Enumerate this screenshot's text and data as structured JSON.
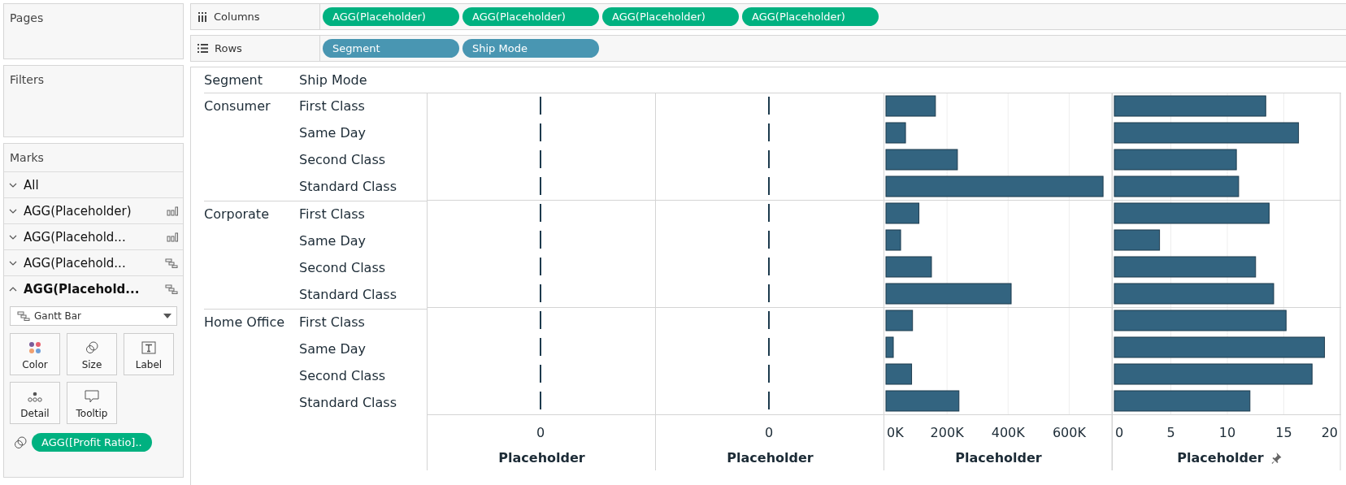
{
  "sidebar": {
    "pages": {
      "title": "Pages"
    },
    "filters": {
      "title": "Filters"
    },
    "marks": {
      "title": "Marks",
      "cards": [
        {
          "label": "All",
          "expanded": false,
          "kind": "all"
        },
        {
          "label": "AGG(Placeholder)",
          "expanded": false,
          "kind": "bar"
        },
        {
          "label": "AGG(Placehold...",
          "expanded": false,
          "kind": "bar"
        },
        {
          "label": "AGG(Placehold...",
          "expanded": false,
          "kind": "gantt"
        },
        {
          "label": "AGG(Placehold...",
          "expanded": true,
          "kind": "gantt"
        }
      ],
      "mark_type": "Gantt Bar",
      "buttons": [
        {
          "label": "Color",
          "kind": "color"
        },
        {
          "label": "Size",
          "kind": "size"
        },
        {
          "label": "Label",
          "kind": "label"
        },
        {
          "label": "Detail",
          "kind": "detail"
        },
        {
          "label": "Tooltip",
          "kind": "tooltip"
        }
      ],
      "fields": [
        {
          "label": "AGG([Profit Ratio]..",
          "kind": "size",
          "color": "#00b180"
        }
      ]
    }
  },
  "shelves": [
    {
      "label": "Columns",
      "kind": "columns",
      "pills": [
        {
          "label": "AGG(Placeholder)",
          "color": "#00b180"
        },
        {
          "label": "AGG(Placeholder)",
          "color": "#00b180"
        },
        {
          "label": "AGG(Placeholder)",
          "color": "#00b180"
        },
        {
          "label": "AGG(Placeholder)",
          "color": "#00b180"
        }
      ]
    },
    {
      "label": "Rows",
      "kind": "rows",
      "pills": [
        {
          "label": "Segment",
          "color": "#4996b2"
        },
        {
          "label": "Ship Mode",
          "color": "#4996b2"
        }
      ]
    }
  ],
  "view": {
    "headers": [
      "Segment",
      "Ship Mode"
    ],
    "groups": [
      {
        "segment": "Consumer",
        "rows": [
          "First Class",
          "Same Day",
          "Second Class",
          "Standard Class"
        ]
      },
      {
        "segment": "Corporate",
        "rows": [
          "First Class",
          "Same Day",
          "Second Class",
          "Standard Class"
        ]
      },
      {
        "segment": "Home Office",
        "rows": [
          "First Class",
          "Same Day",
          "Second Class",
          "Standard Class"
        ]
      }
    ],
    "panes": [
      {
        "kind": "zero_axis",
        "pinned": false,
        "tick": "0",
        "title": "Placeholder"
      },
      {
        "kind": "zero_axis",
        "pinned": false,
        "tick": "0",
        "title": "Placeholder"
      },
      {
        "kind": "chart",
        "pinned": false,
        "chart_data": {
          "type": "bar",
          "orientation": "horizontal",
          "grid": true,
          "xlabel": "Placeholder",
          "xlim": [
            0,
            740000
          ],
          "xticks": [
            {
              "value": 0,
              "label": "0K"
            },
            {
              "value": 200000,
              "label": "200K"
            },
            {
              "value": 400000,
              "label": "400K"
            },
            {
              "value": 600000,
              "label": "600K"
            }
          ],
          "values": [
            162000,
            64000,
            234000,
            711000,
            108000,
            48000,
            149000,
            410000,
            87000,
            24000,
            84000,
            239000
          ]
        }
      },
      {
        "kind": "chart",
        "pinned": true,
        "chart_data": {
          "type": "bar",
          "orientation": "horizontal",
          "grid": true,
          "xlabel": "Placeholder",
          "xlim": [
            0,
            20
          ],
          "xticks": [
            0,
            5,
            10,
            15,
            20
          ],
          "values": [
            13.4,
            16.3,
            10.8,
            11.0,
            13.7,
            4.0,
            12.5,
            14.1,
            15.2,
            18.6,
            17.5,
            12.0
          ]
        }
      }
    ]
  }
}
